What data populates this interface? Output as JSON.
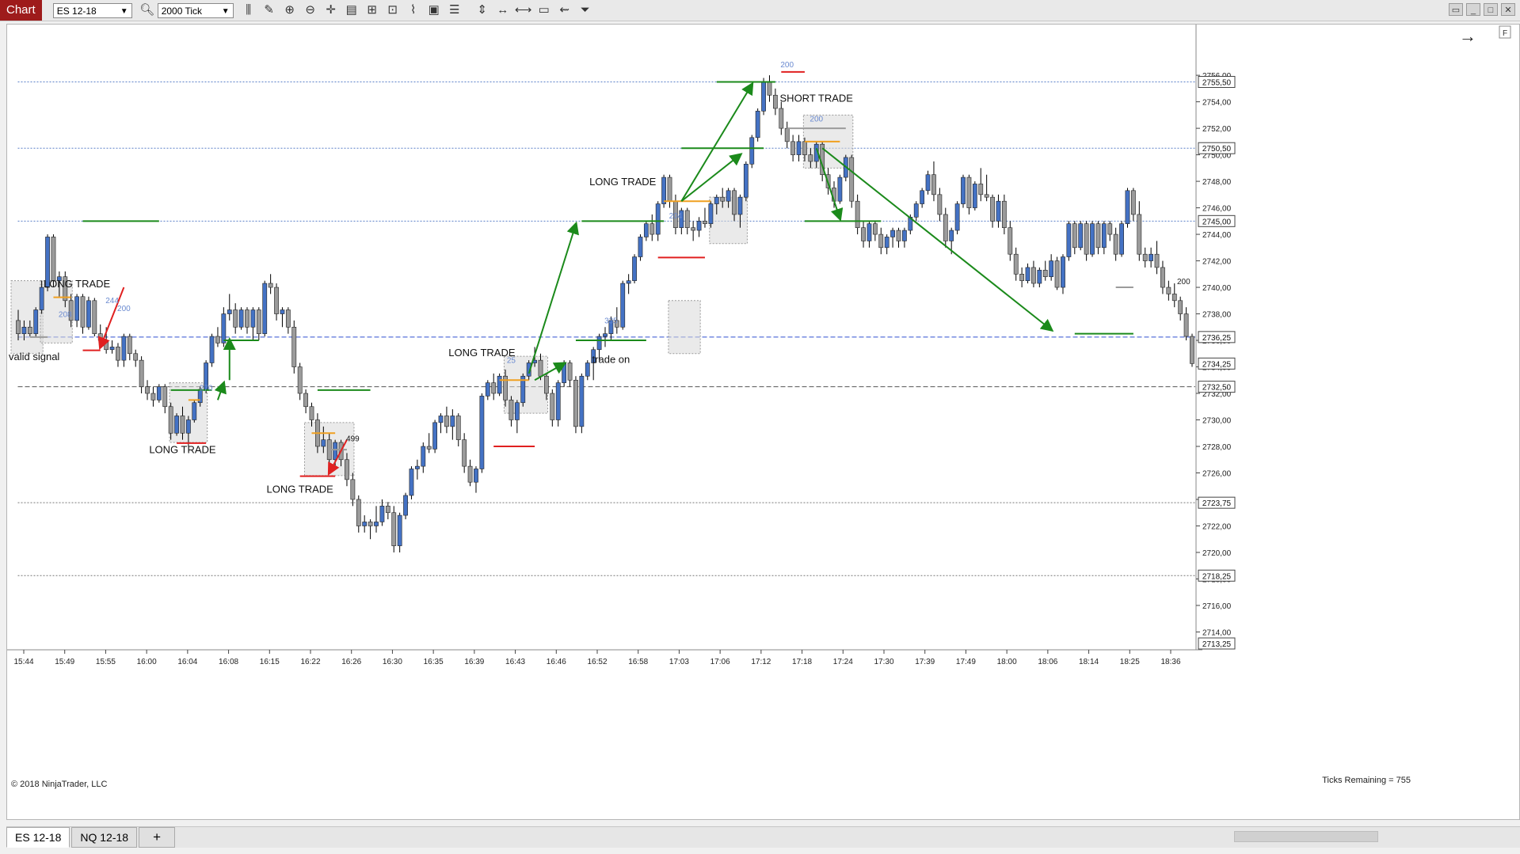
{
  "toolbar": {
    "chart_tab": "Chart",
    "instrument": "ES 12-18",
    "interval": "2000 Tick",
    "icons": [
      "bar-type-icon",
      "pencil-icon",
      "zoom-in-icon",
      "zoom-out-icon",
      "crosshair-icon",
      "properties-icon",
      "strategy-icon",
      "indicator-icon",
      "drawing-tool-icon",
      "data-box-icon",
      "order-list-icon",
      "bar-spacing-icon",
      "scroll-left-icon",
      "scroll-icon",
      "rectangle-icon",
      "link-icon",
      "filter-icon"
    ]
  },
  "chart": {
    "copyright": "© 2018 NinjaTrader, LLC",
    "ticks_remaining": "Ticks Remaining = 755",
    "f_box": "F",
    "arrow_glyph": "→",
    "price_label_default": "200"
  },
  "chart_data": {
    "type": "candlestick",
    "instrument": "ES 12-18",
    "ylim": [
      2713.25,
      2757.5
    ],
    "y_ticks": [
      2714.0,
      2716.0,
      2718.0,
      2720.0,
      2722.0,
      2724.0,
      2726.0,
      2728.0,
      2730.0,
      2732.0,
      2734.0,
      2736.0,
      2738.0,
      2740.0,
      2742.0,
      2744.0,
      2746.0,
      2748.0,
      2750.0,
      2752.0,
      2754.0,
      2756.0
    ],
    "bottom_label": "2713,25",
    "x_ticks": [
      "15:44",
      "15:49",
      "15:55",
      "16:00",
      "16:04",
      "16:08",
      "16:15",
      "16:22",
      "16:26",
      "16:30",
      "16:35",
      "16:39",
      "16:43",
      "16:46",
      "16:52",
      "16:58",
      "17:03",
      "17:06",
      "17:12",
      "17:18",
      "17:24",
      "17:30",
      "17:39",
      "17:49",
      "18:00",
      "18:06",
      "18:14",
      "18:25",
      "18:36"
    ],
    "level_lines": [
      {
        "price": 2755.5,
        "label": "2755,50",
        "style": "dotted",
        "color": "#5a7fc8"
      },
      {
        "price": 2750.5,
        "label": "2750,50",
        "style": "dotted",
        "color": "#5a7fc8"
      },
      {
        "price": 2745.0,
        "label": "2745,00",
        "style": "dotted",
        "color": "#5a7fc8"
      },
      {
        "price": 2736.25,
        "label": "2736,25",
        "style": "dashed",
        "color": "#2f4fd0"
      },
      {
        "price": 2732.5,
        "label": "2732,50",
        "style": "dashed",
        "color": "#555555"
      },
      {
        "price": 2723.75,
        "label": "2723,75",
        "style": "dotted",
        "color": "#777777"
      },
      {
        "price": 2718.25,
        "label": "2718,25",
        "style": "dotted",
        "color": "#777777"
      }
    ],
    "last_price": {
      "price": 2734.25,
      "label": "2734,25"
    },
    "candles": [
      [
        2737.5,
        2738.3,
        2736.0,
        2736.5
      ],
      [
        2736.5,
        2737.5,
        2736.0,
        2737.0
      ],
      [
        2737.0,
        2737.5,
        2736.3,
        2736.5
      ],
      [
        2736.5,
        2738.5,
        2736.3,
        2738.3
      ],
      [
        2738.3,
        2740.5,
        2738.0,
        2740.0
      ],
      [
        2740.0,
        2744.0,
        2739.7,
        2743.8
      ],
      [
        2743.8,
        2744.0,
        2740.0,
        2740.5
      ],
      [
        2740.5,
        2741.2,
        2739.3,
        2740.8
      ],
      [
        2740.8,
        2741.2,
        2738.5,
        2739.0
      ],
      [
        2739.0,
        2739.5,
        2737.0,
        2737.5
      ],
      [
        2737.5,
        2739.5,
        2737.0,
        2739.3
      ],
      [
        2739.3,
        2739.5,
        2736.5,
        2737.0
      ],
      [
        2737.0,
        2739.3,
        2736.8,
        2739.0
      ],
      [
        2739.0,
        2739.2,
        2736.3,
        2736.5
      ],
      [
        2736.5,
        2737.2,
        2735.8,
        2736.0
      ],
      [
        2736.0,
        2737.0,
        2735.0,
        2735.3
      ],
      [
        2735.3,
        2736.0,
        2735.0,
        2735.5
      ],
      [
        2735.5,
        2735.8,
        2734.0,
        2734.5
      ],
      [
        2734.5,
        2736.5,
        2734.0,
        2736.3
      ],
      [
        2736.3,
        2736.5,
        2734.5,
        2735.0
      ],
      [
        2735.0,
        2735.3,
        2734.0,
        2734.5
      ],
      [
        2734.5,
        2734.8,
        2732.0,
        2732.5
      ],
      [
        2732.5,
        2733.0,
        2731.5,
        2732.0
      ],
      [
        2732.0,
        2732.5,
        2731.0,
        2731.5
      ],
      [
        2731.5,
        2732.7,
        2731.3,
        2732.5
      ],
      [
        2732.5,
        2732.7,
        2730.5,
        2731.0
      ],
      [
        2731.0,
        2731.3,
        2728.5,
        2729.0
      ],
      [
        2729.0,
        2730.5,
        2728.8,
        2730.3
      ],
      [
        2730.3,
        2731.0,
        2728.5,
        2729.0
      ],
      [
        2729.0,
        2730.3,
        2728.0,
        2730.0
      ],
      [
        2730.0,
        2731.5,
        2729.8,
        2731.3
      ],
      [
        2731.3,
        2732.5,
        2731.0,
        2732.3
      ],
      [
        2732.3,
        2734.5,
        2732.0,
        2734.3
      ],
      [
        2734.3,
        2736.5,
        2734.0,
        2736.3
      ],
      [
        2736.3,
        2737.0,
        2735.5,
        2735.8
      ],
      [
        2735.8,
        2738.5,
        2735.5,
        2738.0
      ],
      [
        2738.0,
        2739.5,
        2737.5,
        2738.3
      ],
      [
        2738.3,
        2738.8,
        2736.5,
        2737.0
      ],
      [
        2737.0,
        2738.5,
        2736.8,
        2738.3
      ],
      [
        2738.3,
        2738.5,
        2736.5,
        2737.0
      ],
      [
        2737.0,
        2738.5,
        2736.0,
        2738.3
      ],
      [
        2738.3,
        2738.5,
        2736.0,
        2736.5
      ],
      [
        2736.5,
        2740.5,
        2736.3,
        2740.3
      ],
      [
        2740.3,
        2741.0,
        2739.5,
        2740.0
      ],
      [
        2740.0,
        2740.3,
        2737.5,
        2738.0
      ],
      [
        2738.0,
        2738.5,
        2737.0,
        2738.3
      ],
      [
        2738.3,
        2738.5,
        2736.5,
        2737.0
      ],
      [
        2737.0,
        2737.5,
        2733.5,
        2734.0
      ],
      [
        2734.0,
        2734.3,
        2731.5,
        2732.0
      ],
      [
        2732.0,
        2732.3,
        2730.5,
        2731.0
      ],
      [
        2731.0,
        2731.3,
        2729.5,
        2730.0
      ],
      [
        2730.0,
        2730.5,
        2727.5,
        2728.0
      ],
      [
        2728.0,
        2729.5,
        2727.5,
        2728.5
      ],
      [
        2728.5,
        2729.0,
        2726.5,
        2727.0
      ],
      [
        2727.0,
        2728.5,
        2726.5,
        2728.3
      ],
      [
        2728.3,
        2728.5,
        2726.5,
        2727.0
      ],
      [
        2727.0,
        2727.5,
        2725.0,
        2725.5
      ],
      [
        2725.5,
        2726.0,
        2723.5,
        2724.0
      ],
      [
        2724.0,
        2724.3,
        2721.5,
        2722.0
      ],
      [
        2722.0,
        2722.8,
        2721.5,
        2722.3
      ],
      [
        2722.3,
        2722.5,
        2721.0,
        2722.0
      ],
      [
        2722.0,
        2723.5,
        2721.5,
        2722.3
      ],
      [
        2722.3,
        2724.0,
        2722.0,
        2723.5
      ],
      [
        2723.5,
        2723.8,
        2722.5,
        2723.0
      ],
      [
        2723.0,
        2723.5,
        2720.0,
        2720.5
      ],
      [
        2720.5,
        2723.0,
        2720.0,
        2722.8
      ],
      [
        2722.8,
        2724.5,
        2722.5,
        2724.3
      ],
      [
        2724.3,
        2726.5,
        2724.0,
        2726.3
      ],
      [
        2726.3,
        2727.0,
        2725.5,
        2726.5
      ],
      [
        2726.5,
        2728.3,
        2726.0,
        2728.0
      ],
      [
        2728.0,
        2729.0,
        2727.5,
        2727.8
      ],
      [
        2727.8,
        2730.0,
        2727.5,
        2729.8
      ],
      [
        2729.8,
        2730.5,
        2729.0,
        2730.3
      ],
      [
        2730.3,
        2731.0,
        2729.0,
        2729.5
      ],
      [
        2729.5,
        2730.8,
        2728.5,
        2730.3
      ],
      [
        2730.3,
        2730.5,
        2728.0,
        2728.5
      ],
      [
        2728.5,
        2729.0,
        2726.0,
        2726.5
      ],
      [
        2726.5,
        2727.0,
        2725.0,
        2725.3
      ],
      [
        2725.3,
        2726.5,
        2724.5,
        2726.3
      ],
      [
        2726.3,
        2732.0,
        2726.0,
        2731.8
      ],
      [
        2731.8,
        2733.0,
        2731.5,
        2732.8
      ],
      [
        2732.8,
        2733.5,
        2731.5,
        2732.0
      ],
      [
        2732.0,
        2733.5,
        2731.8,
        2733.3
      ],
      [
        2733.3,
        2733.8,
        2731.0,
        2731.5
      ],
      [
        2731.5,
        2731.8,
        2729.5,
        2730.0
      ],
      [
        2730.0,
        2731.5,
        2729.0,
        2731.3
      ],
      [
        2731.3,
        2733.5,
        2731.0,
        2733.3
      ],
      [
        2733.3,
        2734.5,
        2733.0,
        2734.3
      ],
      [
        2734.3,
        2735.5,
        2734.0,
        2734.5
      ],
      [
        2734.5,
        2735.0,
        2733.0,
        2733.3
      ],
      [
        2733.3,
        2733.5,
        2731.5,
        2732.0
      ],
      [
        2732.0,
        2732.3,
        2729.5,
        2730.0
      ],
      [
        2730.0,
        2733.0,
        2729.5,
        2732.8
      ],
      [
        2732.8,
        2734.5,
        2732.5,
        2734.3
      ],
      [
        2734.3,
        2734.5,
        2732.5,
        2733.0
      ],
      [
        2733.0,
        2733.3,
        2729.0,
        2729.5
      ],
      [
        2729.5,
        2733.5,
        2729.0,
        2733.3
      ],
      [
        2733.3,
        2734.5,
        2733.0,
        2734.3
      ],
      [
        2734.3,
        2735.5,
        2733.0,
        2735.3
      ],
      [
        2735.3,
        2736.5,
        2734.5,
        2736.3
      ],
      [
        2736.3,
        2737.0,
        2735.5,
        2736.5
      ],
      [
        2736.5,
        2737.8,
        2736.0,
        2737.5
      ],
      [
        2737.5,
        2738.5,
        2736.5,
        2737.0
      ],
      [
        2737.0,
        2740.5,
        2736.8,
        2740.3
      ],
      [
        2740.3,
        2741.0,
        2739.5,
        2740.5
      ],
      [
        2740.5,
        2742.5,
        2740.3,
        2742.3
      ],
      [
        2742.3,
        2744.0,
        2742.0,
        2743.8
      ],
      [
        2743.8,
        2745.0,
        2743.5,
        2744.8
      ],
      [
        2744.8,
        2745.5,
        2743.5,
        2744.0
      ],
      [
        2744.0,
        2746.5,
        2743.5,
        2746.3
      ],
      [
        2746.3,
        2748.5,
        2746.0,
        2748.3
      ],
      [
        2748.3,
        2748.5,
        2746.0,
        2746.5
      ],
      [
        2746.5,
        2747.0,
        2744.0,
        2744.5
      ],
      [
        2744.5,
        2746.0,
        2744.0,
        2745.8
      ],
      [
        2745.8,
        2746.0,
        2744.0,
        2744.5
      ],
      [
        2744.5,
        2745.0,
        2743.5,
        2744.3
      ],
      [
        2744.3,
        2745.3,
        2743.8,
        2745.0
      ],
      [
        2745.0,
        2746.0,
        2744.5,
        2744.8
      ],
      [
        2744.8,
        2746.5,
        2744.5,
        2746.3
      ],
      [
        2746.3,
        2747.0,
        2745.5,
        2746.8
      ],
      [
        2746.8,
        2747.5,
        2746.0,
        2746.5
      ],
      [
        2746.5,
        2747.5,
        2746.0,
        2747.3
      ],
      [
        2747.3,
        2747.5,
        2745.0,
        2745.5
      ],
      [
        2745.5,
        2747.0,
        2744.5,
        2746.8
      ],
      [
        2746.8,
        2749.5,
        2746.5,
        2749.3
      ],
      [
        2749.3,
        2751.5,
        2749.0,
        2751.3
      ],
      [
        2751.3,
        2753.5,
        2751.0,
        2753.3
      ],
      [
        2753.3,
        2755.8,
        2753.0,
        2755.5
      ],
      [
        2755.5,
        2756.0,
        2754.0,
        2754.5
      ],
      [
        2754.5,
        2755.0,
        2753.0,
        2753.5
      ],
      [
        2753.5,
        2754.0,
        2751.5,
        2752.0
      ],
      [
        2752.0,
        2752.5,
        2750.5,
        2751.0
      ],
      [
        2751.0,
        2751.5,
        2749.5,
        2750.0
      ],
      [
        2750.0,
        2751.5,
        2749.5,
        2751.0
      ],
      [
        2751.0,
        2751.3,
        2749.5,
        2750.0
      ],
      [
        2750.0,
        2750.5,
        2749.0,
        2749.5
      ],
      [
        2749.5,
        2751.0,
        2749.0,
        2750.8
      ],
      [
        2750.8,
        2751.0,
        2748.0,
        2748.5
      ],
      [
        2748.5,
        2749.0,
        2747.0,
        2747.5
      ],
      [
        2747.5,
        2748.0,
        2746.0,
        2746.5
      ],
      [
        2746.5,
        2748.5,
        2746.3,
        2748.3
      ],
      [
        2748.3,
        2750.0,
        2748.0,
        2749.8
      ],
      [
        2749.8,
        2750.0,
        2746.0,
        2746.5
      ],
      [
        2746.5,
        2747.0,
        2744.0,
        2744.5
      ],
      [
        2744.5,
        2745.0,
        2743.0,
        2743.5
      ],
      [
        2743.5,
        2745.0,
        2743.0,
        2744.8
      ],
      [
        2744.8,
        2745.0,
        2743.5,
        2744.0
      ],
      [
        2744.0,
        2744.5,
        2742.5,
        2743.0
      ],
      [
        2743.0,
        2744.0,
        2742.5,
        2743.8
      ],
      [
        2743.8,
        2744.5,
        2743.0,
        2744.3
      ],
      [
        2744.3,
        2744.5,
        2743.0,
        2743.5
      ],
      [
        2743.5,
        2744.5,
        2743.0,
        2744.3
      ],
      [
        2744.3,
        2745.5,
        2744.0,
        2745.3
      ],
      [
        2745.3,
        2746.5,
        2745.0,
        2746.3
      ],
      [
        2746.3,
        2747.5,
        2746.0,
        2747.3
      ],
      [
        2747.3,
        2748.8,
        2747.0,
        2748.5
      ],
      [
        2748.5,
        2749.5,
        2746.5,
        2747.0
      ],
      [
        2747.0,
        2747.5,
        2745.0,
        2745.5
      ],
      [
        2745.5,
        2746.0,
        2743.0,
        2743.5
      ],
      [
        2743.5,
        2744.5,
        2742.5,
        2744.3
      ],
      [
        2744.3,
        2746.5,
        2744.0,
        2746.3
      ],
      [
        2746.3,
        2748.5,
        2746.0,
        2748.3
      ],
      [
        2748.3,
        2748.5,
        2745.5,
        2746.0
      ],
      [
        2746.0,
        2748.0,
        2745.8,
        2747.8
      ],
      [
        2747.8,
        2749.0,
        2746.5,
        2747.0
      ],
      [
        2747.0,
        2748.5,
        2746.5,
        2746.8
      ],
      [
        2746.8,
        2747.0,
        2744.5,
        2745.0
      ],
      [
        2745.0,
        2747.0,
        2744.5,
        2746.5
      ],
      [
        2746.5,
        2747.0,
        2744.0,
        2744.5
      ],
      [
        2744.5,
        2745.0,
        2742.0,
        2742.5
      ],
      [
        2742.5,
        2743.0,
        2740.5,
        2741.0
      ],
      [
        2741.0,
        2741.5,
        2740.0,
        2740.5
      ],
      [
        2740.5,
        2741.8,
        2740.3,
        2741.5
      ],
      [
        2741.5,
        2742.0,
        2740.0,
        2740.3
      ],
      [
        2740.3,
        2741.5,
        2740.0,
        2741.3
      ],
      [
        2741.3,
        2742.0,
        2740.5,
        2740.8
      ],
      [
        2740.8,
        2742.5,
        2740.5,
        2742.0
      ],
      [
        2742.0,
        2742.3,
        2739.8,
        2740.0
      ],
      [
        2740.0,
        2742.5,
        2739.5,
        2742.3
      ],
      [
        2742.3,
        2745.0,
        2742.0,
        2744.8
      ],
      [
        2744.8,
        2745.0,
        2742.5,
        2743.0
      ],
      [
        2743.0,
        2745.0,
        2742.8,
        2744.8
      ],
      [
        2744.8,
        2745.0,
        2742.0,
        2742.5
      ],
      [
        2742.5,
        2745.0,
        2742.3,
        2744.8
      ],
      [
        2744.8,
        2745.0,
        2742.5,
        2743.0
      ],
      [
        2743.0,
        2745.0,
        2742.5,
        2744.8
      ],
      [
        2744.8,
        2745.0,
        2743.5,
        2744.0
      ],
      [
        2744.0,
        2744.5,
        2742.0,
        2742.5
      ],
      [
        2742.5,
        2745.0,
        2742.3,
        2744.8
      ],
      [
        2744.8,
        2747.5,
        2744.5,
        2747.3
      ],
      [
        2747.3,
        2747.5,
        2745.0,
        2745.5
      ],
      [
        2745.5,
        2746.5,
        2742.0,
        2742.5
      ],
      [
        2742.5,
        2743.0,
        2741.5,
        2742.0
      ],
      [
        2742.0,
        2743.0,
        2741.5,
        2742.5
      ],
      [
        2742.5,
        2743.5,
        2741.0,
        2741.5
      ],
      [
        2741.5,
        2742.0,
        2739.5,
        2740.0
      ],
      [
        2740.0,
        2740.5,
        2739.0,
        2739.5
      ],
      [
        2739.5,
        2740.3,
        2738.5,
        2739.0
      ],
      [
        2739.0,
        2739.3,
        2737.5,
        2738.0
      ],
      [
        2738.0,
        2738.5,
        2736.0,
        2736.3
      ],
      [
        2736.3,
        2736.5,
        2734.0,
        2734.25
      ]
    ],
    "annotations": [
      {
        "text": "valid signal"
      },
      {
        "text": "LONG TRADE"
      },
      {
        "text": "LONG TRADE"
      },
      {
        "text": "LONG TRADE"
      },
      {
        "text": "LONG TRADE"
      },
      {
        "text": "trade on"
      },
      {
        "text": "LONG TRADE"
      },
      {
        "text": "SHORT TRADE"
      }
    ],
    "small_labels": [
      "208",
      "244",
      "200",
      "270",
      "499",
      "25",
      "335",
      "204",
      "200",
      "200"
    ],
    "colors": {
      "bull": "#4472c4",
      "bear": "#9b9b9b",
      "wick": "#000000",
      "green": "#1b8a1b",
      "red": "#e02020",
      "orange": "#f0a020",
      "grid_blue": "#5a7fc8",
      "box_fill": "#d8d8d8"
    }
  },
  "bottom_tabs": [
    {
      "label": "ES 12-18",
      "active": true
    },
    {
      "label": "NQ 12-18",
      "active": false
    }
  ],
  "add_tab_label": "+"
}
